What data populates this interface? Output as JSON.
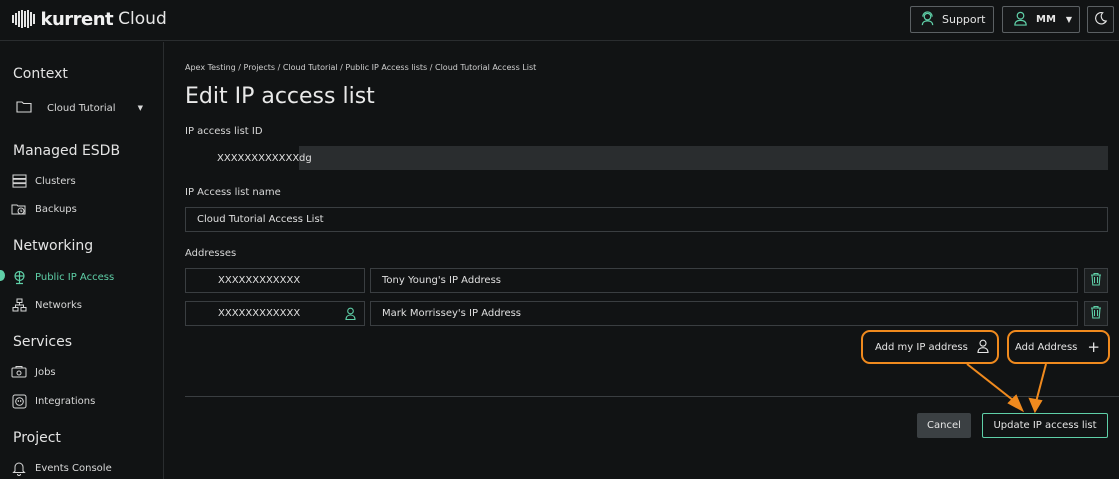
{
  "header": {
    "brand": "kurrent",
    "brand_suffix": "Cloud",
    "support_label": "Support",
    "user_initials": "MM"
  },
  "sidebar": {
    "context_title": "Context",
    "context_value": "Cloud Tutorial",
    "managed_title": "Managed ESDB",
    "clusters": "Clusters",
    "backups": "Backups",
    "networking_title": "Networking",
    "public_ip_access": "Public IP Access",
    "networks": "Networks",
    "services_title": "Services",
    "jobs": "Jobs",
    "integrations": "Integrations",
    "project_title": "Project",
    "events_console": "Events Console"
  },
  "main": {
    "breadcrumb": "Apex Testing / Projects / Cloud Tutorial / Public IP Access lists / Cloud Tutorial Access List",
    "title": "Edit IP access list",
    "id_label": "IP access list ID",
    "id_masked": "XXXXXXXXXXXX",
    "id_suffix": "dg",
    "name_label": "IP Access list name",
    "name_value": "Cloud Tutorial Access List",
    "addresses_label": "Addresses",
    "addresses": [
      {
        "ip": "XXXXXXXXXXXX",
        "description": "Tony Young's IP Address"
      },
      {
        "ip": "XXXXXXXXXXXX",
        "description": "Mark Morrissey's IP Address"
      }
    ],
    "add_my_ip_label": "Add my IP address",
    "add_address_label": "Add Address",
    "add_address_icon": "+",
    "cancel_label": "Cancel",
    "update_label": "Update IP access list"
  },
  "colors": {
    "accent": "#5fd0a8",
    "annotation": "#f08a1e",
    "background": "#111314"
  }
}
